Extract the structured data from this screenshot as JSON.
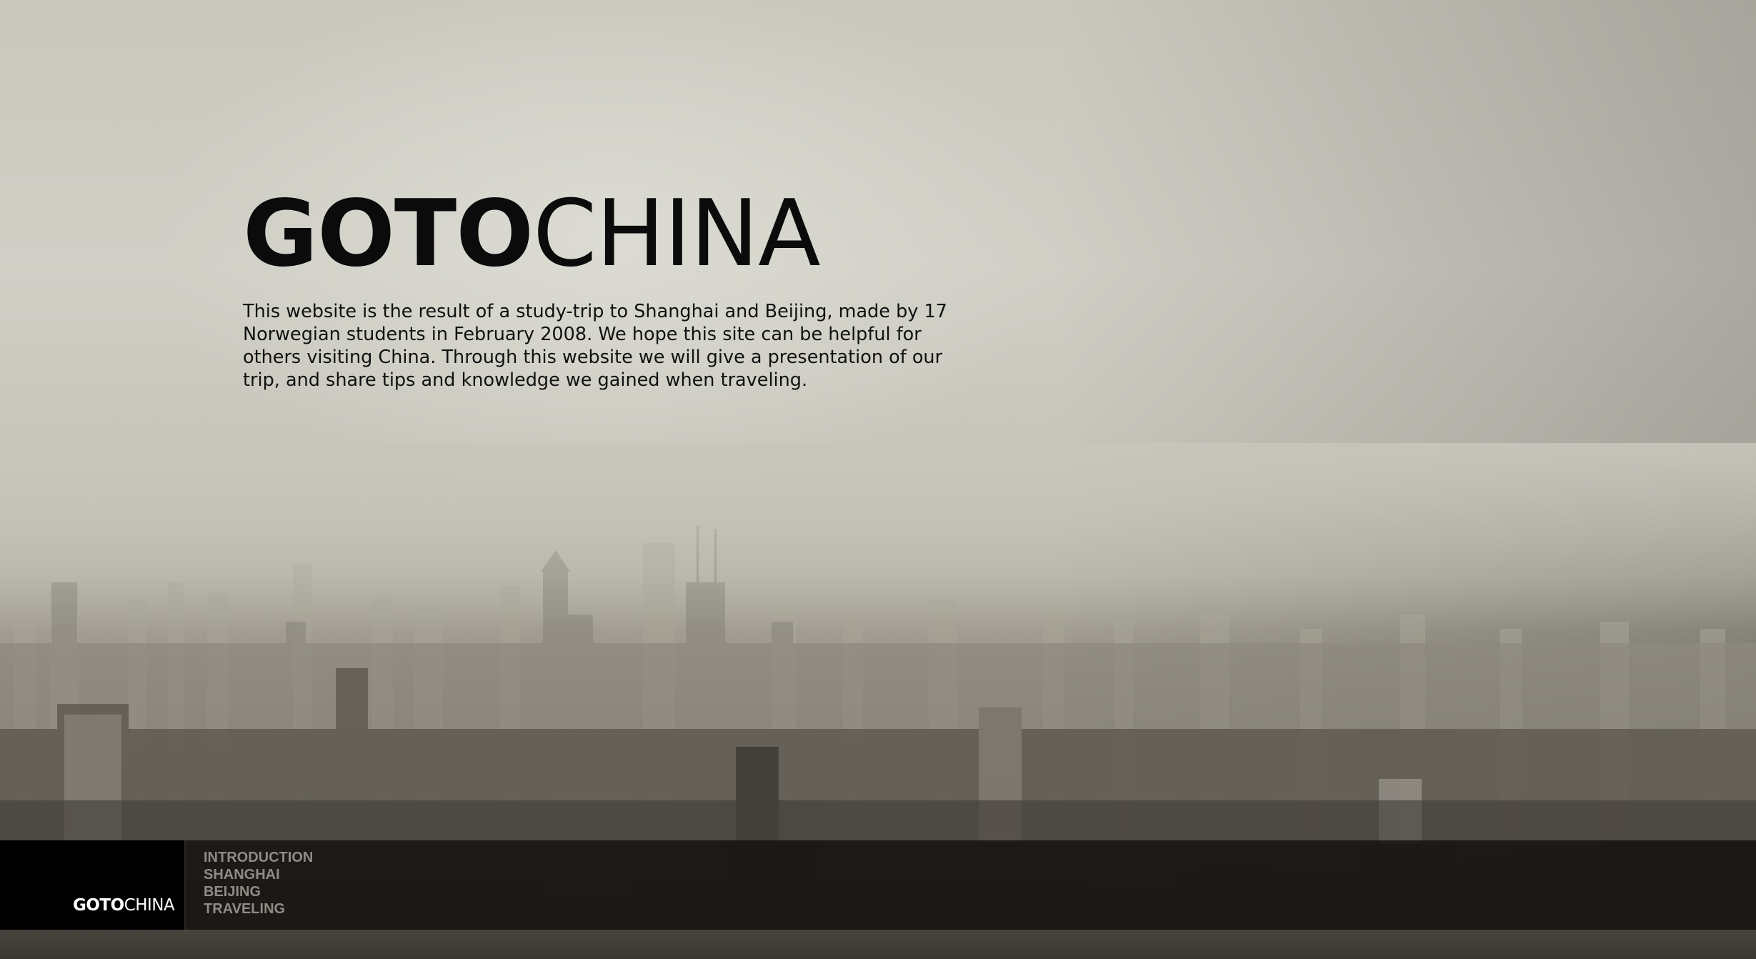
{
  "hero": {
    "logo_bold": "GOTO",
    "logo_light": "CHINA",
    "intro_text": "This website is the result of a study-trip to Shanghai and Beijing, made by 17 Norwegian students in February 2008. We hope this site can be helpful for others visiting China. Through this website we will give a presentation of our trip, and share tips and knowledge we gained when traveling."
  },
  "footer": {
    "brand_bold": "GOTO",
    "brand_light": "CHINA",
    "nav": [
      {
        "label": "INTRODUCTION"
      },
      {
        "label": "SHANGHAI"
      },
      {
        "label": "BEIJING"
      },
      {
        "label": "TRAVELING"
      }
    ]
  },
  "colors": {
    "bar_background": "#000000",
    "nav_text": "#8f8c86",
    "heading_text": "#0b0b0b"
  }
}
